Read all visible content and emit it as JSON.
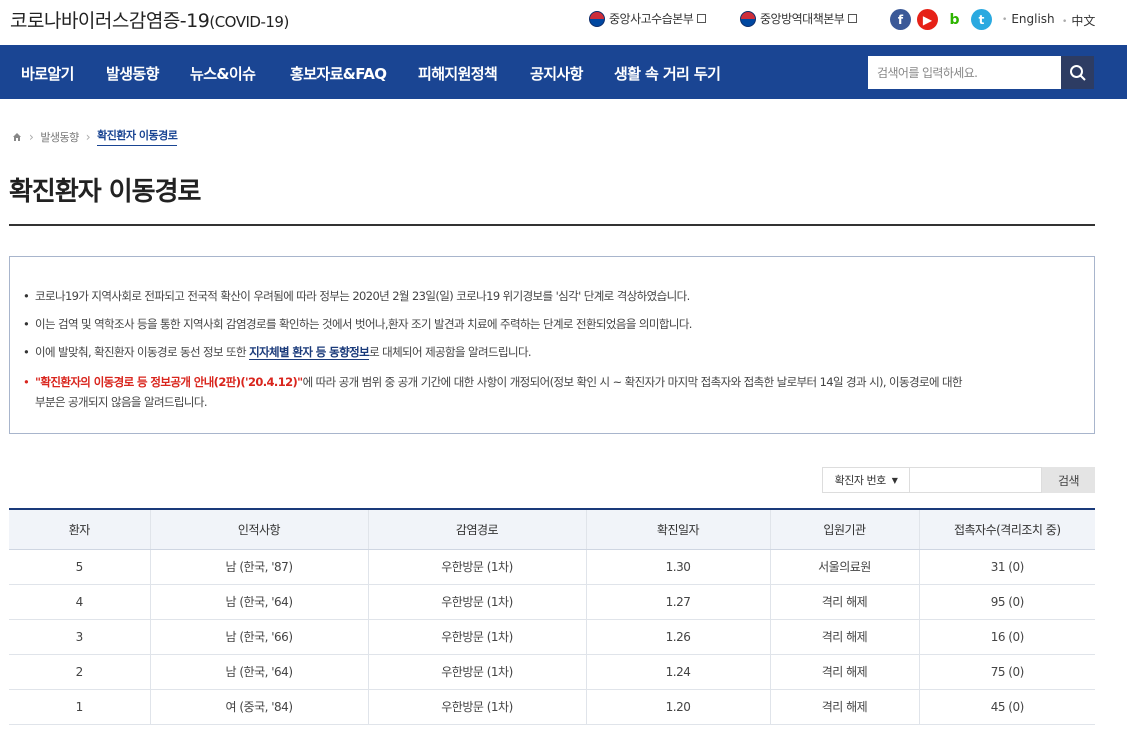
{
  "header": {
    "site_title": "코로나바이러스감염증-19",
    "site_title_sub": "(COVID-19)",
    "links": [
      {
        "label": "중앙사고수습본부",
        "icon": "korea-emblem-icon"
      },
      {
        "label": "중앙방역대책본부",
        "icon": "korea-emblem-icon"
      }
    ],
    "sns": [
      {
        "icon": "facebook-icon",
        "glyph": "f"
      },
      {
        "icon": "youtube-icon",
        "glyph": "▶"
      },
      {
        "icon": "blog-icon",
        "glyph": "b"
      },
      {
        "icon": "twitter-icon",
        "glyph": "t"
      }
    ],
    "languages": [
      "English",
      "中文"
    ]
  },
  "nav": {
    "items": [
      "바로알기",
      "발생동향",
      "뉴스&이슈",
      "홍보자료&FAQ",
      "피해지원정책",
      "공지사항",
      "생활 속 거리 두기"
    ],
    "search_placeholder": "검색어를 입력하세요.",
    "search_icon": "search-icon"
  },
  "breadcrumb": {
    "home_icon": "home-icon",
    "items": [
      "발생동향",
      "확진환자 이동경로"
    ]
  },
  "page_title": "확진환자 이동경로",
  "notice": {
    "line1": "코로나19가 지역사회로 전파되고 전국적 확산이 우려됨에 따라 정부는 2020년 2월 23일(일) 코로나19 위기경보를 '심각' 단계로 격상하였습니다.",
    "line2": "이는 검역 및 역학조사 등을 통한 지역사회 감염경로를 확인하는 것에서 벗어나,환자 조기 발견과 치료에 주력하는 단계로 전환되었음을 의미합니다.",
    "line3_pre": "이에 발맞춰, 확진환자 이동경로 동선 정보 또한 ",
    "line3_link": "지자체별 환자 등 동향정보",
    "line3_post": "로 대체되어 제공함을 알려드립니다.",
    "line4_red": "\"확진환자의 이동경로 등 정보공개 안내(2판)('20.4.12)\"",
    "line4_post": "에 따라 공개 범위 중 공개 기간에 대한 사항이 개정되어(정보 확인 시 ~ 확진자가 마지막 접촉자와 접촉한 날로부터 14일 경과 시), 이동경로에 대한",
    "line5": "부분은 공개되지 않음을 알려드립니다."
  },
  "search": {
    "select_label": "확진자 번호",
    "input_value": "",
    "button_label": "검색"
  },
  "table": {
    "columns": [
      "환자",
      "인적사항",
      "감염경로",
      "확진일자",
      "입원기관",
      "접촉자수(격리조치 중)"
    ],
    "rows": [
      [
        "5",
        "남 (한국, '87)",
        "우한방문 (1차)",
        "1.30",
        "서울의료원",
        "31 (0)"
      ],
      [
        "4",
        "남 (한국, '64)",
        "우한방문 (1차)",
        "1.27",
        "격리 해제",
        "95 (0)"
      ],
      [
        "3",
        "남 (한국, '66)",
        "우한방문 (1차)",
        "1.26",
        "격리 해제",
        "16 (0)"
      ],
      [
        "2",
        "남 (한국, '64)",
        "우한방문 (1차)",
        "1.24",
        "격리 해제",
        "75 (0)"
      ],
      [
        "1",
        "여 (중국, '84)",
        "우한방문 (1차)",
        "1.20",
        "격리 해제",
        "45 (0)"
      ]
    ]
  },
  "colors": {
    "nav_bg": "#1a4593",
    "accent": "#1a3a7a",
    "notice_red": "#d9251d"
  }
}
